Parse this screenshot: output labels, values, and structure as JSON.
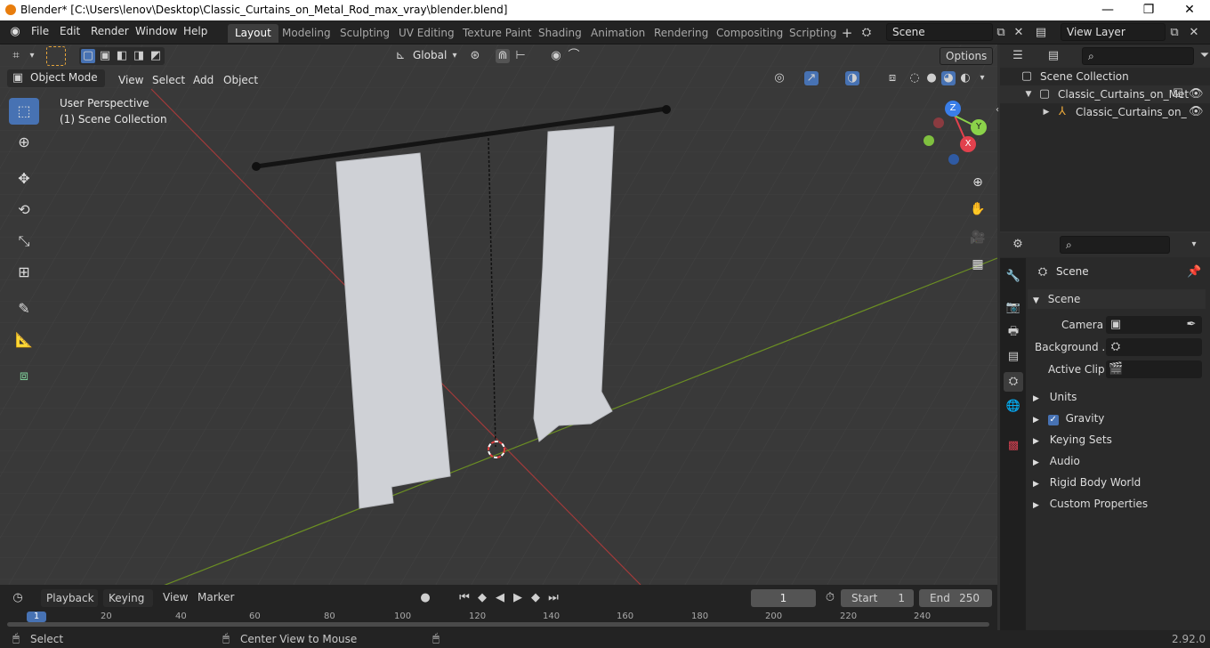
{
  "window": {
    "title": "Blender* [C:\\Users\\lenov\\Desktop\\Classic_Curtains_on_Metal_Rod_max_vray\\blender.blend]",
    "controls": [
      "—",
      "❐",
      "✕"
    ]
  },
  "menubar": [
    "File",
    "Edit",
    "Render",
    "Window",
    "Help"
  ],
  "workspaces": [
    "Layout",
    "Modeling",
    "Sculpting",
    "UV Editing",
    "Texture Paint",
    "Shading",
    "Animation",
    "Rendering",
    "Compositing",
    "Scripting"
  ],
  "active_workspace": "Layout",
  "scene_selector": {
    "value": "Scene"
  },
  "view_layer_selector": {
    "value": "View Layer"
  },
  "viewport_header": {
    "transform_orientation": "Global",
    "options_label": "Options",
    "mode": "Object Mode",
    "menus": [
      "View",
      "Select",
      "Add",
      "Object"
    ]
  },
  "viewport_overlay_text": {
    "perspective": "User Perspective",
    "collection": "(1) Scene Collection"
  },
  "axis_gizmo": {
    "x": "X",
    "y": "Y",
    "z": "Z",
    "colors": {
      "x": "#e2414d",
      "y": "#8bd24a",
      "z": "#3a7ee8"
    }
  },
  "outliner": {
    "root": "Scene Collection",
    "items": [
      {
        "label": "Classic_Curtains_on_Met",
        "type": "collection"
      },
      {
        "label": "Classic_Curtains_on_",
        "type": "object"
      }
    ]
  },
  "properties": {
    "header": "Scene",
    "panel_title": "Scene",
    "fields": [
      {
        "label": "Camera",
        "icon": "camera-icon"
      },
      {
        "label": "Background ...",
        "icon": "scene-icon"
      },
      {
        "label": "Active Clip",
        "icon": "clip-icon"
      }
    ],
    "collapsed_panels": [
      "Units",
      "Gravity",
      "Keying Sets",
      "Audio",
      "Rigid Body World",
      "Custom Properties"
    ],
    "gravity_checked": true
  },
  "timeline": {
    "menus": [
      "Playback",
      "Keying",
      "View",
      "Marker"
    ],
    "current_frame": "1",
    "start_label": "Start",
    "start": "1",
    "end_label": "End",
    "end": "250",
    "ruler_ticks": [
      "1",
      "20",
      "40",
      "60",
      "80",
      "100",
      "120",
      "140",
      "160",
      "180",
      "200",
      "220",
      "240"
    ]
  },
  "statusbar": {
    "left_action": "Select",
    "middle_action": "Center View to Mouse",
    "version": "2.92.0"
  },
  "colors": {
    "accent": "#4772b3",
    "viewport_bg": "#393939",
    "x_axis_line": "#a33a3a",
    "y_axis_line": "#6b8e23"
  }
}
